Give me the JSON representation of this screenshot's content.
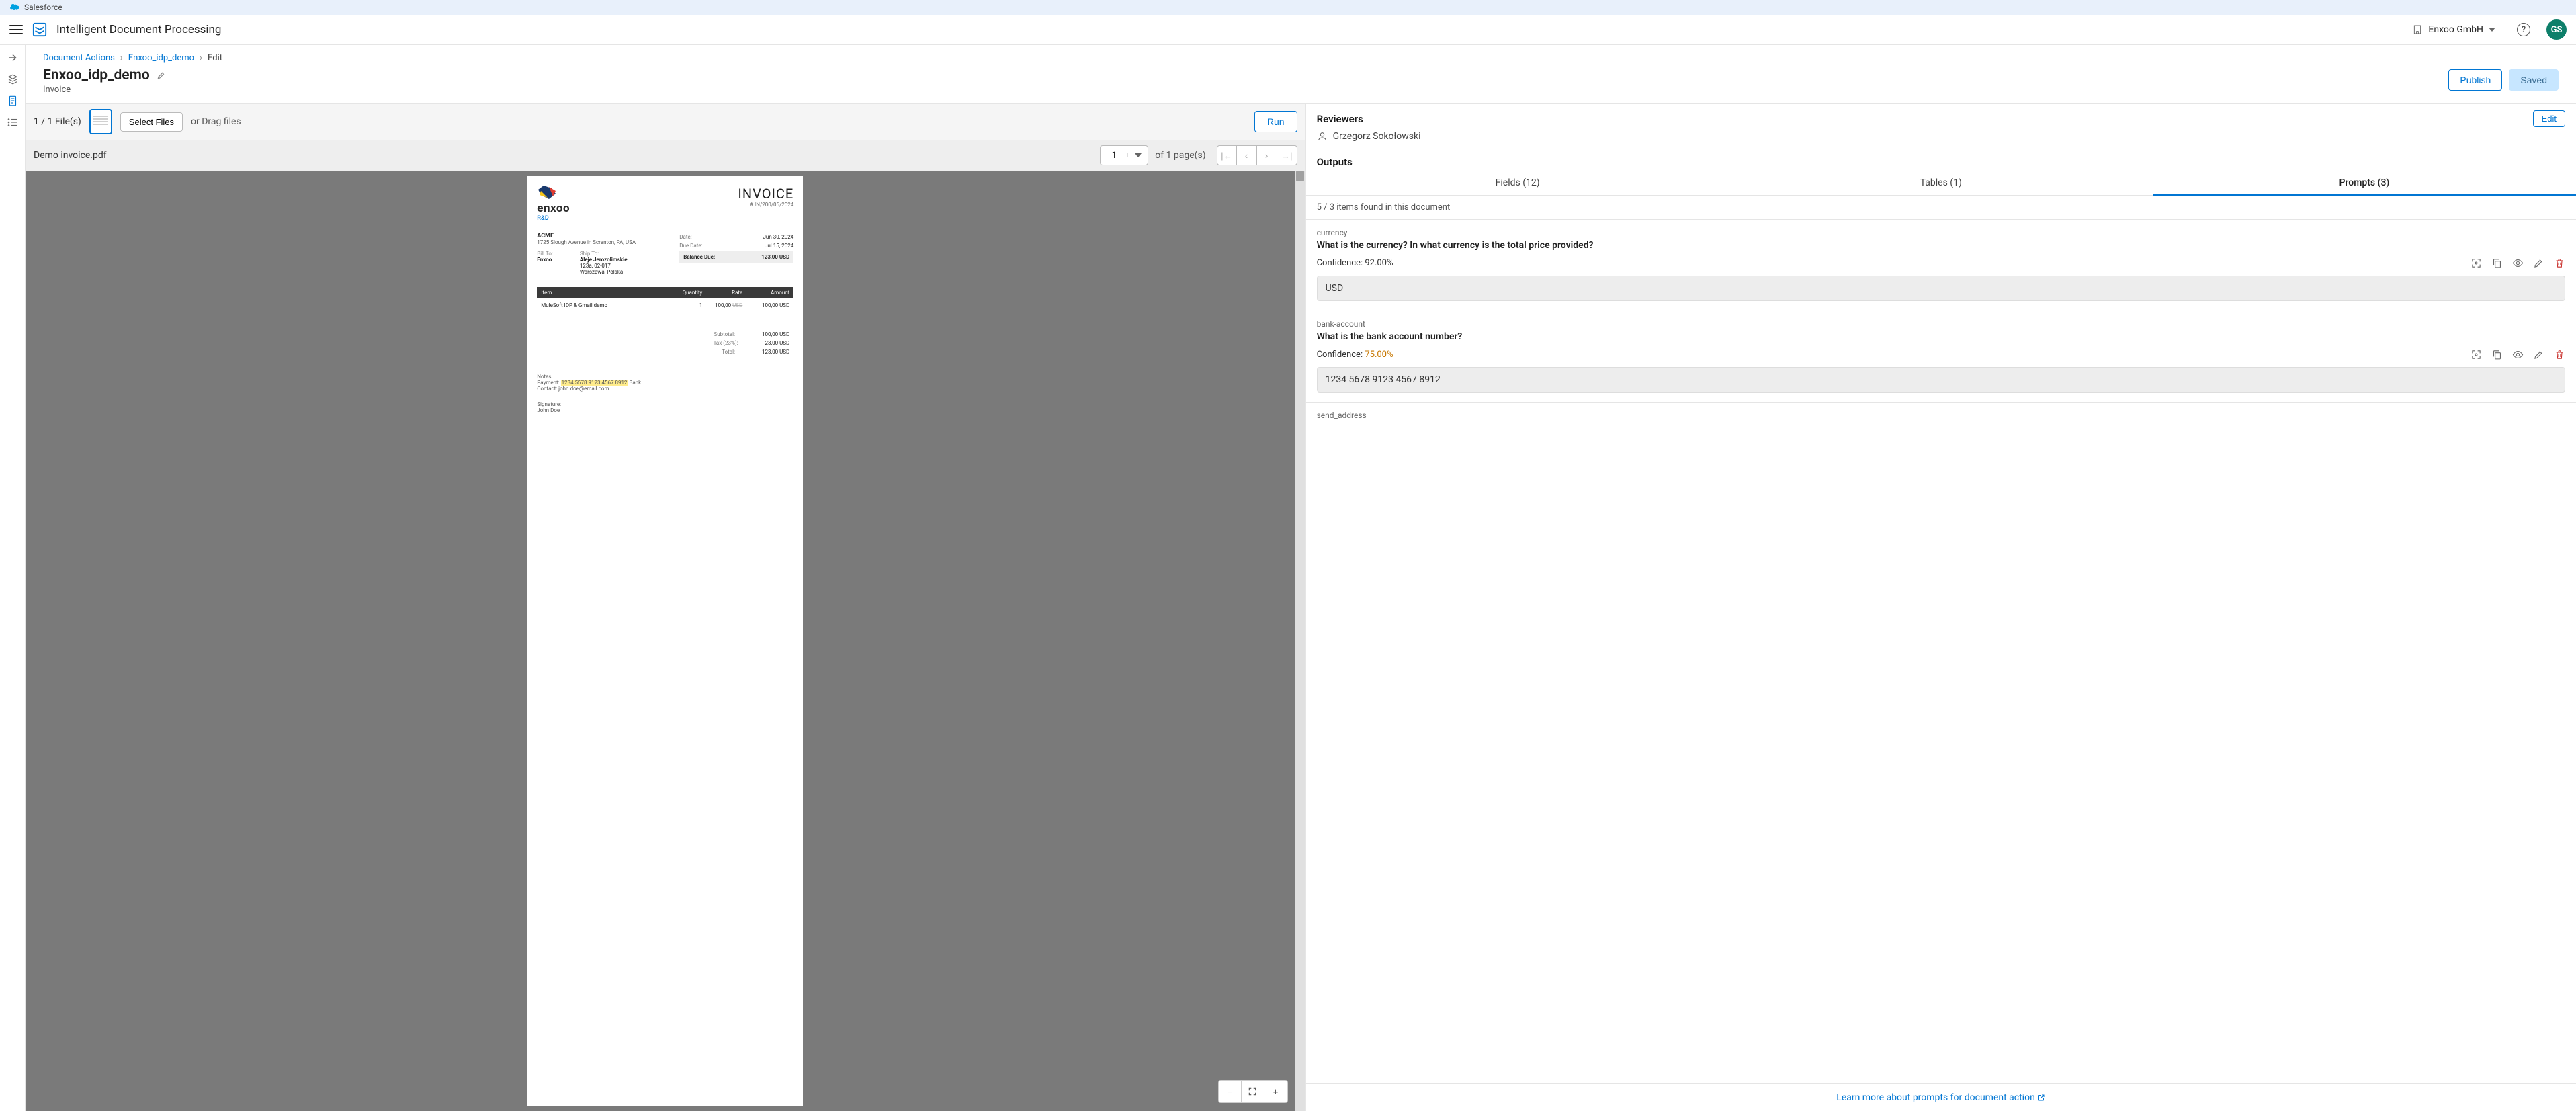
{
  "brand": "Salesforce",
  "appTitle": "Intelligent Document Processing",
  "org": "Enxoo GmbH",
  "avatar": "GS",
  "rail": {
    "expandTip": "expand"
  },
  "crumbs": {
    "root": "Document Actions",
    "item": "Enxoo_idp_demo",
    "leaf": "Edit"
  },
  "page": {
    "title": "Enxoo_idp_demo",
    "subtitle": "Invoice"
  },
  "actions": {
    "publish": "Publish",
    "saved": "Saved"
  },
  "fileBar": {
    "count": "1 / 1 File(s)",
    "select": "Select Files",
    "drag": "or Drag files",
    "run": "Run"
  },
  "docBar": {
    "name": "Demo invoice.pdf",
    "page": "1",
    "ofPages": "of 1 page(s)"
  },
  "invoice": {
    "brand": "enxoo",
    "brandSub": "R&D",
    "heading": "INVOICE",
    "number": "# IN/200/06/2024",
    "vendor": {
      "name": "ACME",
      "addr": "1725 Slough Avenue in Scranton, PA, USA"
    },
    "billToLabel": "Bill To:",
    "shipToLabel": "Ship To:",
    "billTo": "Enxoo",
    "shipTo": {
      "l1": "Aleje Jerozolimskie",
      "l2": "123a, 02-017",
      "l3": "Warszawa, Polska"
    },
    "dateLabel": "Date:",
    "date": "Jun 30, 2024",
    "dueLabel": "Due Date:",
    "due": "Jul 15, 2024",
    "balanceLabel": "Balance Due:",
    "balance": "123,00 USD",
    "cols": {
      "item": "Item",
      "qty": "Quantity",
      "rate": "Rate",
      "amount": "Amount"
    },
    "line": {
      "item": "MuleSoft IDP & Gmail demo",
      "qty": "1",
      "rate": "100,00",
      "rateStruck": "USD",
      "amount": "100,00 USD"
    },
    "subLabel": "Subtotal:",
    "sub": "100,00 USD",
    "taxLabel": "Tax (23%):",
    "tax": "23,00 USD",
    "totalLabel": "Total:",
    "total": "123,00 USD",
    "notesLabel": "Notes:",
    "paymentLabel": "Payment:",
    "paymentAcct": "1234 5678 9123 4567 8912",
    "paymentTail": " Bank",
    "contactLabel": "Contact:",
    "contact": "john.doe@email.com",
    "sigLabel": "Signature:",
    "sig": "John Doe"
  },
  "reviewers": {
    "title": "Reviewers",
    "edit": "Edit",
    "name": "Grzegorz Sokołowski"
  },
  "outputs": {
    "title": "Outputs",
    "tabFields": "Fields (12)",
    "tabTables": "Tables (1)",
    "tabPrompts": "Prompts (3)",
    "found": "5 / 3 items found in this document"
  },
  "prompts": [
    {
      "key": "currency",
      "q": "What is the currency? In what currency is the total price provided?",
      "confLabel": "Confidence: ",
      "conf": "92.00%",
      "warn": false,
      "value": "USD"
    },
    {
      "key": "bank-account",
      "q": "What is the bank account number?",
      "confLabel": "Confidence: ",
      "conf": "75.00%",
      "warn": true,
      "value": "1234  5678  9123  4567  8912"
    },
    {
      "key": "send_address",
      "q": "",
      "confLabel": "",
      "conf": "",
      "warn": false,
      "value": ""
    }
  ],
  "learnMore": "Learn more about prompts for document action"
}
